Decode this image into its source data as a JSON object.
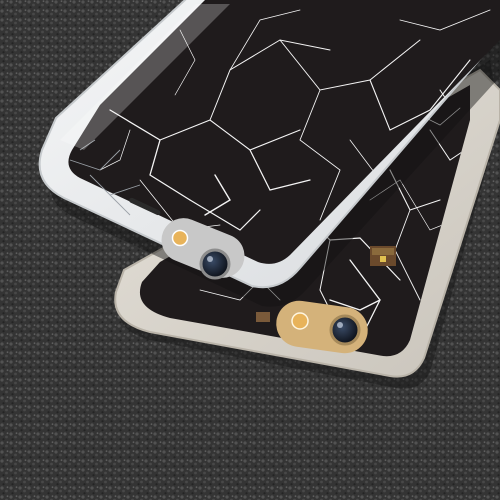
{
  "scene": {
    "palette": {
      "carpet_base": "#3c3c3c",
      "carpet_light": "#6a6a6a",
      "carpet_dark": "#222222",
      "front_case": "#eceef0",
      "back_case": "#d9d6cf",
      "case_shadow": "#1b1b1b",
      "screen_black": "#1f1b1c",
      "crack_white": "#f4f4f4",
      "lens_ring_silver": "#c8c8c8",
      "lens_ring_gold": "#d4b27a",
      "lens_glass": "#1a2230",
      "flash_amber": "#e8b35a"
    },
    "objects": [
      {
        "id": "carpet",
        "icon": "textured-carpet"
      },
      {
        "id": "back-phone",
        "icon": "phone-case-cracked-print"
      },
      {
        "id": "front-phone",
        "icon": "phone-case-cracked-print"
      }
    ]
  }
}
